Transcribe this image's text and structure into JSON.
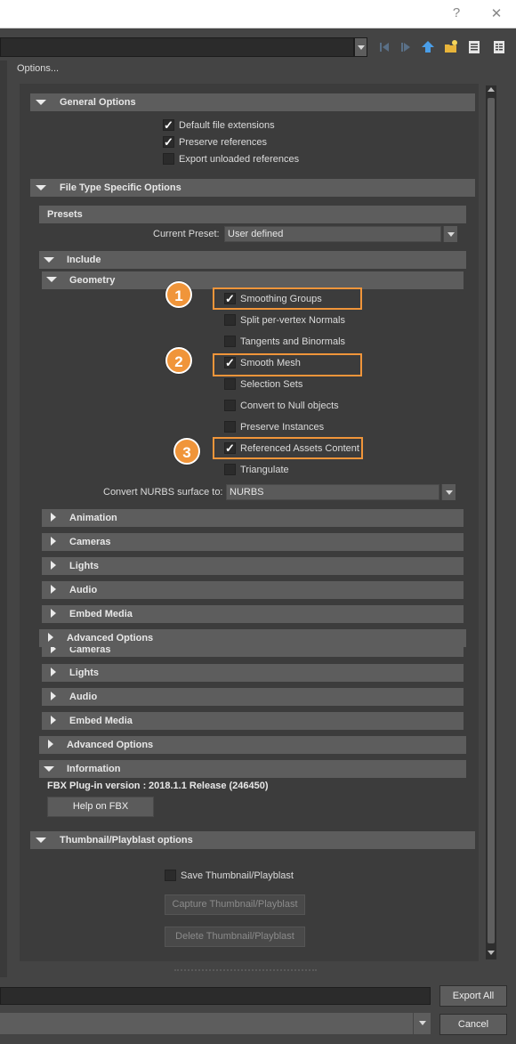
{
  "window": {
    "help_button": "?",
    "close_button": "✕"
  },
  "toolbar": {
    "path_value": "",
    "icons": [
      "back-icon",
      "forward-icon",
      "up-folder-icon",
      "new-folder-icon",
      "list-view-icon",
      "detail-view-icon"
    ]
  },
  "options_label": "Options...",
  "general_options": {
    "title": "General Options",
    "items": [
      {
        "label": "Default file extensions",
        "checked": true
      },
      {
        "label": "Preserve references",
        "checked": true
      },
      {
        "label": "Export unloaded references",
        "checked": false
      }
    ]
  },
  "file_type_options": {
    "title": "File Type Specific Options"
  },
  "presets": {
    "title": "Presets",
    "current_preset_label": "Current Preset:",
    "current_preset_value": "User defined"
  },
  "include": {
    "title": "Include"
  },
  "geometry": {
    "title": "Geometry",
    "items": [
      {
        "label": "Smoothing Groups",
        "checked": true
      },
      {
        "label": "Split per-vertex Normals",
        "checked": false
      },
      {
        "label": "Tangents and Binormals",
        "checked": false
      },
      {
        "label": "Smooth Mesh",
        "checked": true
      },
      {
        "label": "Selection Sets",
        "checked": false
      },
      {
        "label": "Convert to Null objects",
        "checked": false
      },
      {
        "label": "Preserve Instances",
        "checked": false
      },
      {
        "label": "Referenced Assets Content",
        "checked": true
      },
      {
        "label": "Triangulate",
        "checked": false
      }
    ],
    "nurbs_label": "Convert NURBS surface to:",
    "nurbs_value": "NURBS"
  },
  "callouts": [
    "1",
    "2",
    "3"
  ],
  "collapsed_sections_a": [
    "Animation",
    "Cameras",
    "Lights",
    "Audio",
    "Embed Media"
  ],
  "advanced_options_overlay": "Advanced Options",
  "partial_section": "Cameras",
  "collapsed_sections_b": [
    "Lights",
    "Audio",
    "Embed Media"
  ],
  "advanced_options": "Advanced Options",
  "information": {
    "title": "Information",
    "version_label": "FBX Plug-in version :",
    "version_value": "2018.1.1 Release (246450)",
    "help_button": "Help on FBX"
  },
  "thumbnail": {
    "title": "Thumbnail/Playblast options",
    "save_label": "Save Thumbnail/Playblast",
    "capture_button": "Capture Thumbnail/Playblast",
    "delete_button": "Delete Thumbnail/Playblast"
  },
  "dialog": {
    "export_button": "Export All",
    "cancel_button": "Cancel",
    "filename_value": "",
    "filetype_value": ""
  },
  "colors": {
    "accent": "#f0953a",
    "header": "#5d5d5d",
    "panel": "#3c3c3c",
    "background": "#444444"
  }
}
